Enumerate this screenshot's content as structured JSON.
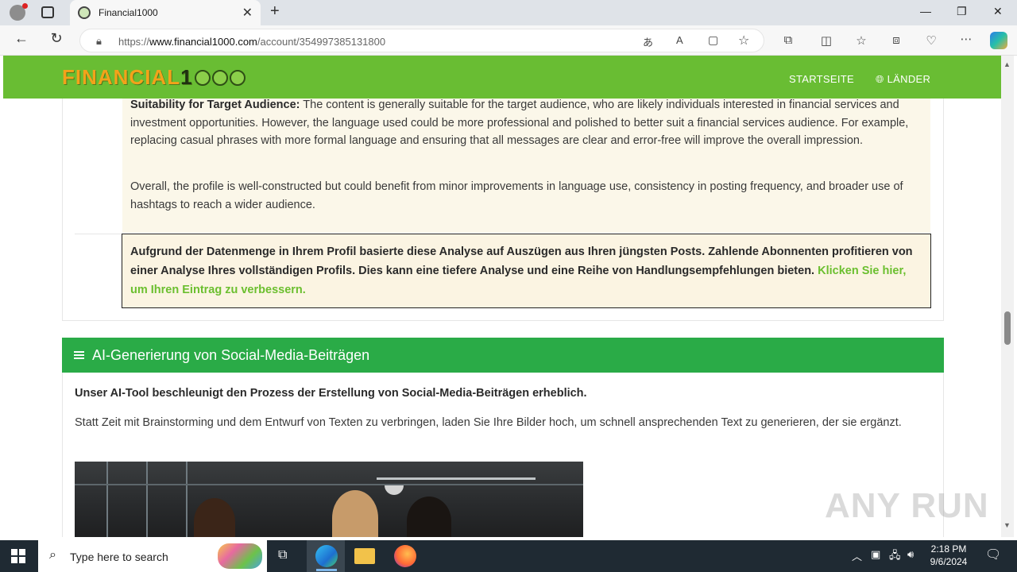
{
  "browser": {
    "tab_title": "Financial1000",
    "url_prefix": "https://",
    "url_host": "www.financial1000.com",
    "url_path": "/account/354997385131800"
  },
  "site": {
    "logo_text": "FINANCIAL",
    "logo_num": "1",
    "nav": [
      "STARTSEITE",
      "LÄNDER"
    ]
  },
  "analysis": {
    "suitability_label": "Suitability for Target Audience:",
    "suitability_text": " The content is generally suitable for the target audience, who are likely individuals interested in financial services and investment opportunities. However, the language used could be more professional and polished to better suit a financial services audience. For example, replacing casual phrases with more formal language and ensuring that all messages are clear and error-free will improve the overall impression.",
    "overall_text": "Overall, the profile is well-constructed but could benefit from minor improvements in language use, consistency in posting frequency, and broader use of hashtags to reach a wider audience."
  },
  "notice": {
    "text": "Aufgrund der Datenmenge in Ihrem Profil basierte diese Analyse auf Auszügen aus Ihren jüngsten Posts. Zahlende Abonnenten profitieren von einer Analyse Ihres vollständigen Profils. Dies kann eine tiefere Analyse und eine Reihe von Handlungsempfehlungen bieten. ",
    "link": "Klicken Sie hier, um Ihren Eintrag zu verbessern."
  },
  "ai_section": {
    "heading": "AI-Generierung von Social-Media-Beiträgen",
    "lead": "Unser AI-Tool beschleunigt den Prozess der Erstellung von Social-Media-Beiträgen erheblich.",
    "body": "Statt Zeit mit Brainstorming und dem Entwurf von Texten zu verbringen, laden Sie Ihre Bilder hoch, um schnell ansprechenden Text zu generieren, der sie ergänzt."
  },
  "watermark": "ANY RUN",
  "taskbar": {
    "search_placeholder": "Type here to search",
    "time": "2:18 PM",
    "date": "9/6/2024"
  },
  "colors": {
    "header_green": "#69bd33",
    "section_green": "#2aab47",
    "link_green": "#6bbf2f",
    "logo_orange": "#f3a21a"
  }
}
